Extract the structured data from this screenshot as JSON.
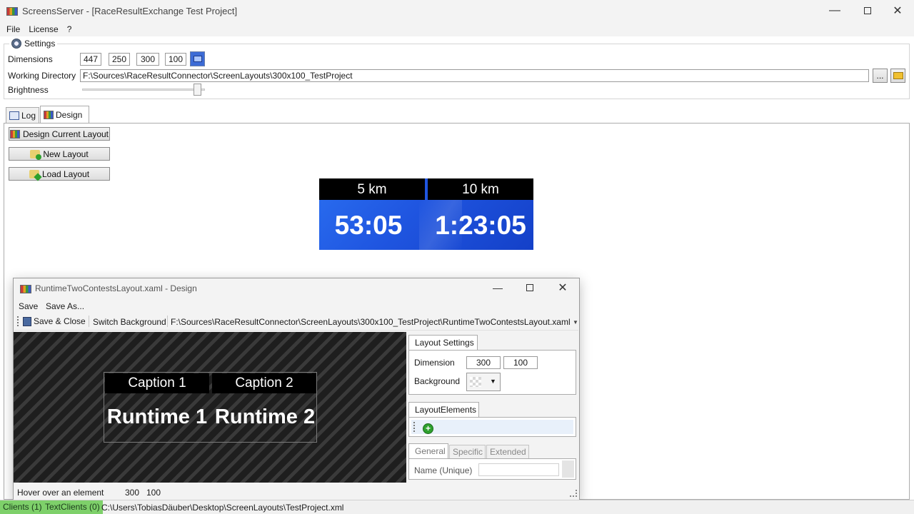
{
  "window": {
    "title": "ScreensServer - [RaceResultExchange Test Project]"
  },
  "menu": {
    "items": [
      "File",
      "License",
      "?"
    ]
  },
  "settings": {
    "group_label": "Settings",
    "dimensions_label": "Dimensions",
    "dimensions": [
      "447",
      "250",
      "300",
      "100"
    ],
    "working_dir_label": "Working Directory",
    "working_dir": "F:\\Sources\\RaceResultConnector\\ScreenLayouts\\300x100_TestProject",
    "browse_label": "...",
    "brightness_label": "Brightness",
    "brightness_level": 0.97
  },
  "tabs": [
    {
      "label": "Log",
      "active": false
    },
    {
      "label": "Design",
      "active": true
    }
  ],
  "design_buttons": {
    "design_current": "Design Current Layout",
    "new_layout": "New Layout",
    "load_layout": "Load Layout"
  },
  "preview": {
    "cap1": "5 km",
    "cap2": "10 km",
    "time1": "53:05",
    "time2": "1:23:05"
  },
  "design_window": {
    "title": "RuntimeTwoContestsLayout.xaml - Design",
    "menu": [
      "Save",
      "Save As..."
    ],
    "toolbar": {
      "save_close": "Save & Close",
      "switch_bg": "Switch Background",
      "path": "F:\\Sources\\RaceResultConnector\\ScreenLayouts\\300x100_TestProject\\RuntimeTwoContestsLayout.xaml"
    },
    "canvas": {
      "caption1": "Caption 1",
      "caption2": "Caption 2",
      "runtime1": "Runtime 1",
      "runtime2": "Runtime 2"
    },
    "layout_settings": {
      "tab": "Layout Settings",
      "dimension_label": "Dimension",
      "width": "300",
      "height": "100",
      "background_label": "Background"
    },
    "layout_elements": {
      "tab": "LayoutElements"
    },
    "element_tabs": [
      "General",
      "Specific",
      "Extended"
    ],
    "name_label": "Name (Unique)",
    "status": {
      "hover": "Hover over an element",
      "w": "300",
      "h": "100"
    }
  },
  "statusbar": {
    "clients": "Clients (1)",
    "textclients": "TextClients (0)",
    "path": "C:\\Users\\TobiasDäuber\\Desktop\\ScreenLayouts\\TestProject.xml"
  },
  "colors": {
    "accent_blue": "#1f55e0",
    "status_green": "#7ed06a"
  }
}
